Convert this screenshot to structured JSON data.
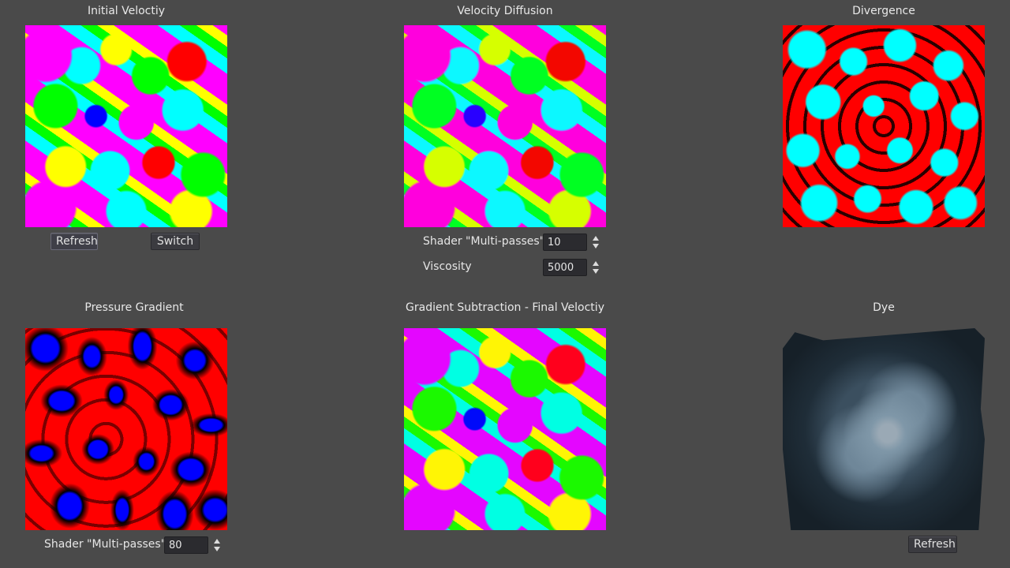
{
  "panels": {
    "initial": {
      "title": "Initial Veloctiy",
      "refresh_label": "Refresh",
      "switch_label": "Switch"
    },
    "diffusion": {
      "title": "Velocity Diffusion",
      "passes_label": "Shader \"Multi-passes\"",
      "passes_value": "10",
      "viscosity_label": "Viscosity",
      "viscosity_value": "5000"
    },
    "divergence": {
      "title": "Divergence"
    },
    "pressure": {
      "title": "Pressure Gradient",
      "passes_label": "Shader \"Multi-passes\"",
      "passes_value": "80"
    },
    "final": {
      "title": "Gradient Subtraction - Final Veloctiy"
    },
    "dye": {
      "title": "Dye",
      "refresh_label": "Refresh"
    }
  },
  "colors": {
    "background": "#4a4a4a",
    "button_bg": "#3b3b40",
    "spin_bg": "#2b2b2f"
  }
}
